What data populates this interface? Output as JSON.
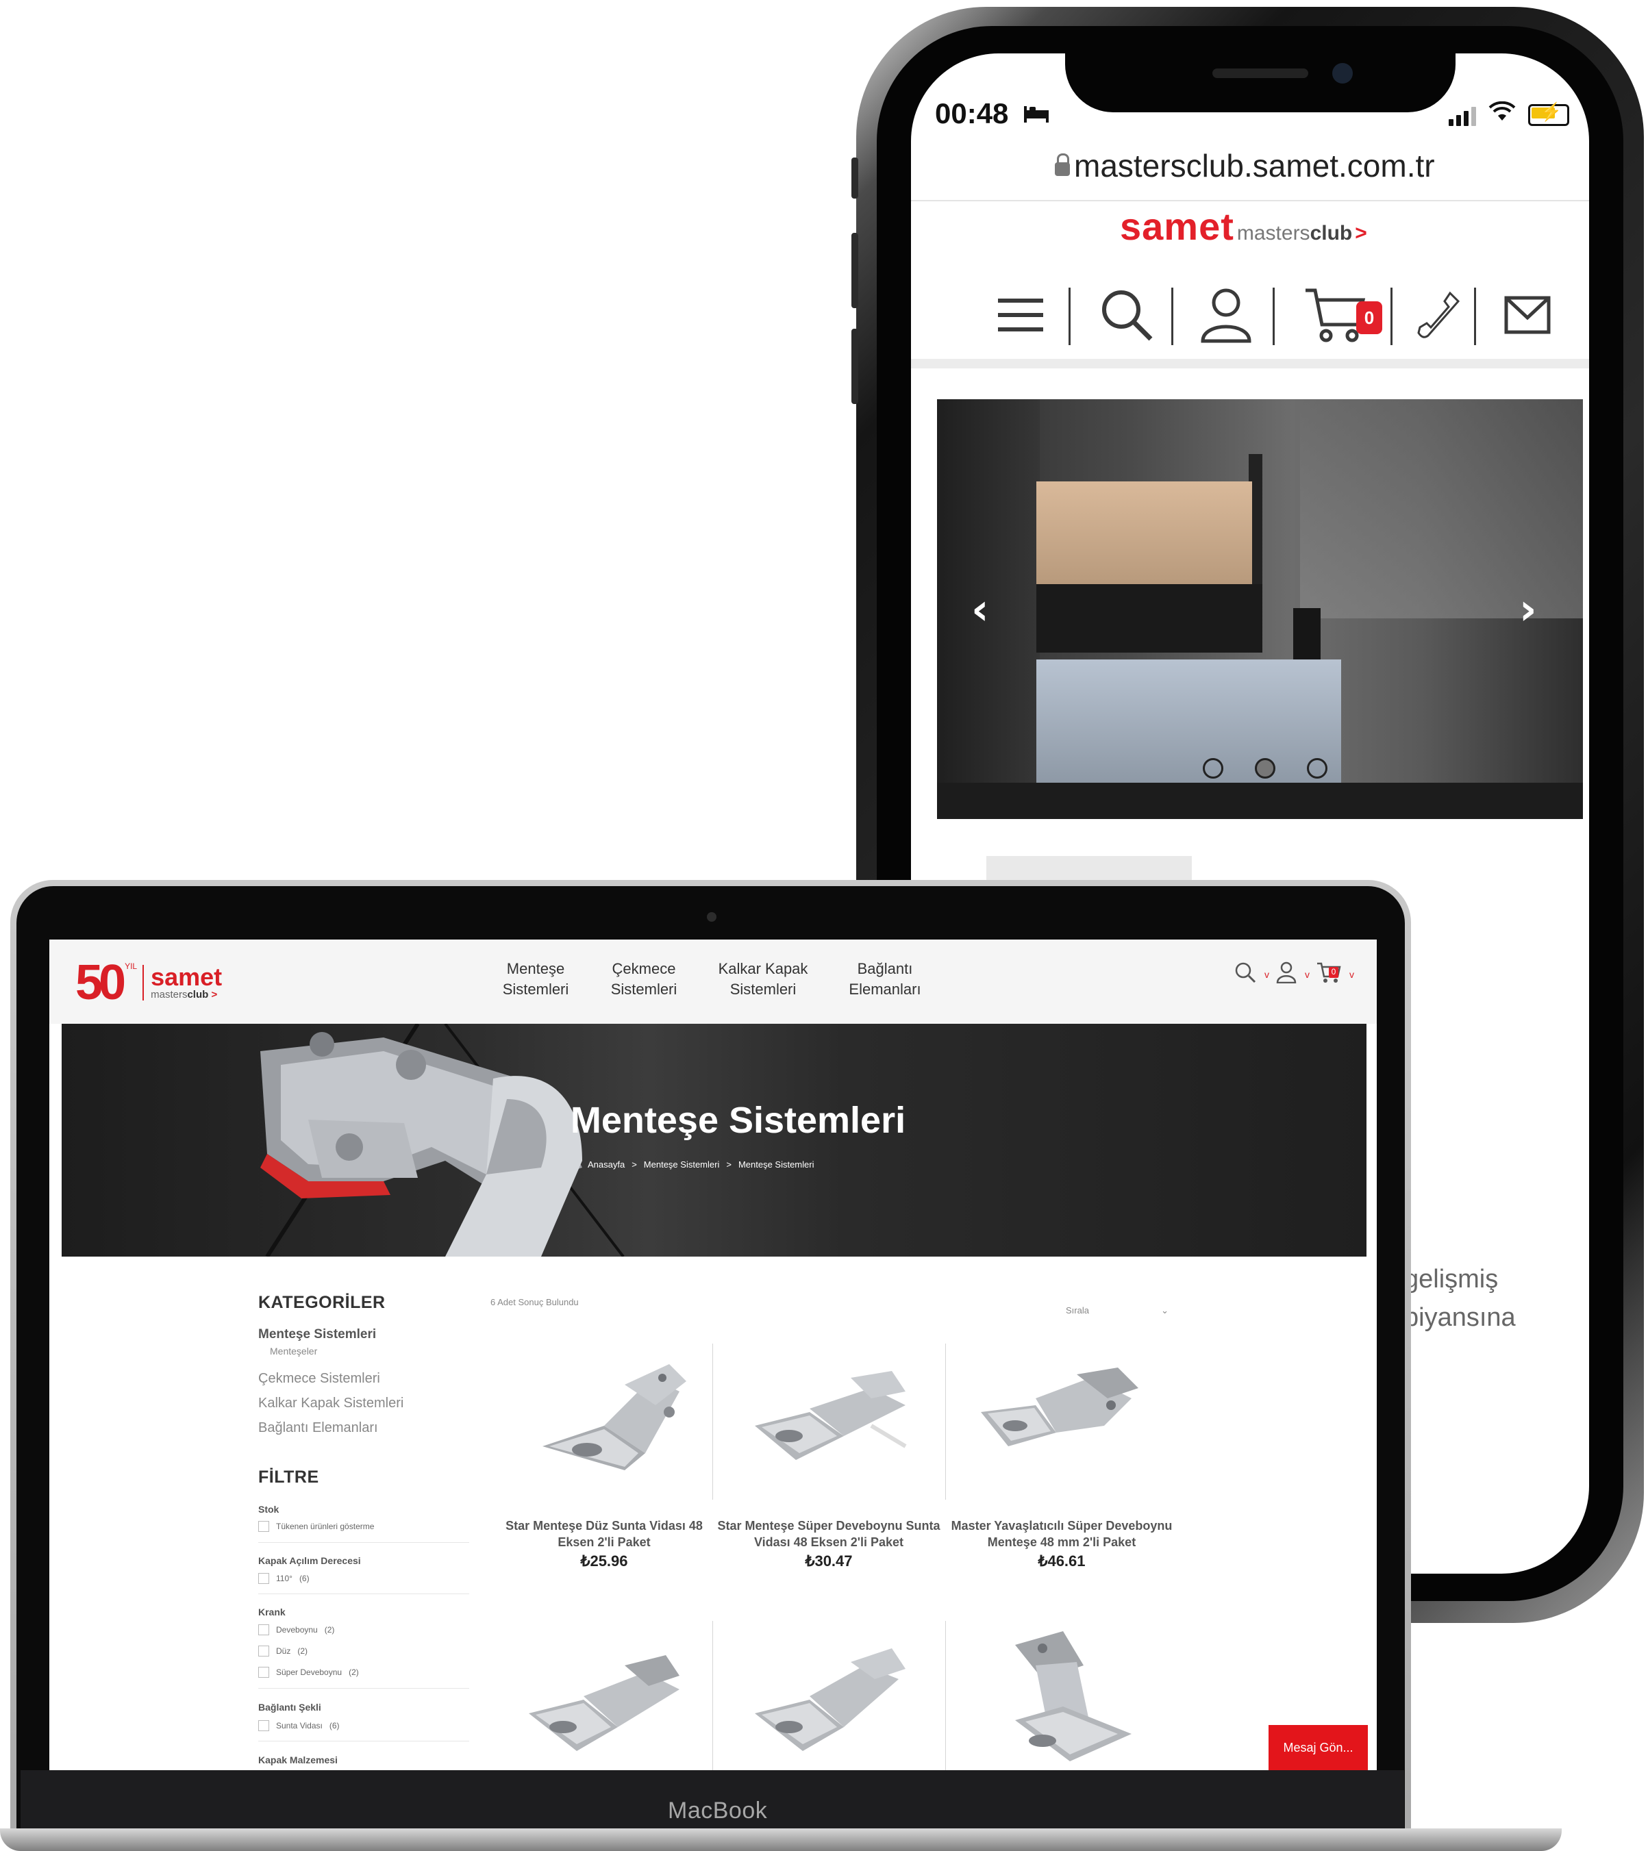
{
  "phone": {
    "status_time": "00:48",
    "url": "mastersclub.samet.com.tr",
    "logo": {
      "brand": "samet",
      "club_prefix": "masters",
      "club_suffix": "club",
      "arrow": ">"
    },
    "icons": [
      "menu-icon",
      "search-icon",
      "user-icon",
      "cart-icon",
      "phone-icon",
      "mail-icon"
    ],
    "cart_count": "0",
    "slider": {
      "slides": 3,
      "active_slide": 2
    },
    "partial_text": [
      "gelişmiş",
      "biyansına"
    ]
  },
  "laptop": {
    "device_label": "MacBook",
    "logo": {
      "fifty": "50",
      "yil": "YIL",
      "brand": "samet",
      "club_prefix": "masters",
      "club_suffix": "club",
      "arrow": ">"
    },
    "nav": [
      {
        "label": "Menteşe\nSistemleri"
      },
      {
        "label": "Çekmece\nSistemleri"
      },
      {
        "label": "Kalkar Kapak\nSistemleri"
      },
      {
        "label": "Bağlantı\nElemanları"
      }
    ],
    "cart_count": "0",
    "hero": {
      "title": "Menteşe Sistemleri",
      "breadcrumb": [
        "Anasayfa",
        ">",
        "Menteşe Sistemleri",
        ">",
        "Menteşe Sistemleri"
      ]
    },
    "sidebar": {
      "categories_title": "KATEGORİLER",
      "categories": [
        {
          "label": "Menteşe Sistemleri",
          "sub": "Menteşeler"
        },
        {
          "label": "Çekmece Sistemleri"
        },
        {
          "label": "Kalkar Kapak Sistemleri"
        },
        {
          "label": "Bağlantı Elemanları"
        }
      ],
      "filter_title": "FİLTRE",
      "filters": [
        {
          "title": "Stok",
          "options": [
            {
              "label": "Tükenen ürünleri gösterme",
              "count": ""
            }
          ]
        },
        {
          "title": "Kapak Açılım Derecesi",
          "options": [
            {
              "label": "110°",
              "count": "(6)"
            }
          ]
        },
        {
          "title": "Krank",
          "options": [
            {
              "label": "Deveboynu",
              "count": "(2)"
            },
            {
              "label": "Düz",
              "count": "(2)"
            },
            {
              "label": "Süper Deveboynu",
              "count": "(2)"
            }
          ]
        },
        {
          "title": "Bağlantı Şekli",
          "options": [
            {
              "label": "Sunta Vidası",
              "count": "(6)"
            }
          ]
        },
        {
          "title": "Kapak Malzemesi",
          "options": []
        }
      ]
    },
    "results_text": "6 Adet Sonuç Bulundu",
    "sort_label": "Sırala",
    "products": [
      {
        "name": "Star Menteşe Düz Sunta Vidası 48 Eksen 2'li Paket",
        "price": "₺25.96"
      },
      {
        "name": "Star Menteşe Süper Deveboynu Sunta Vidası 48 Eksen 2'li Paket",
        "price": "₺30.47"
      },
      {
        "name": "Master Yavaşlatıcılı Süper Deveboynu Menteşe 48 mm 2'li Paket",
        "price": "₺46.61"
      },
      {
        "name": "",
        "price": ""
      },
      {
        "name": "",
        "price": ""
      },
      {
        "name": "",
        "price": ""
      }
    ],
    "chat_button": "Mesaj Gön..."
  },
  "colors": {
    "brand_red": "#e3202a",
    "chat_red": "#e3151b",
    "hero_dark": "#2a2a2a"
  }
}
